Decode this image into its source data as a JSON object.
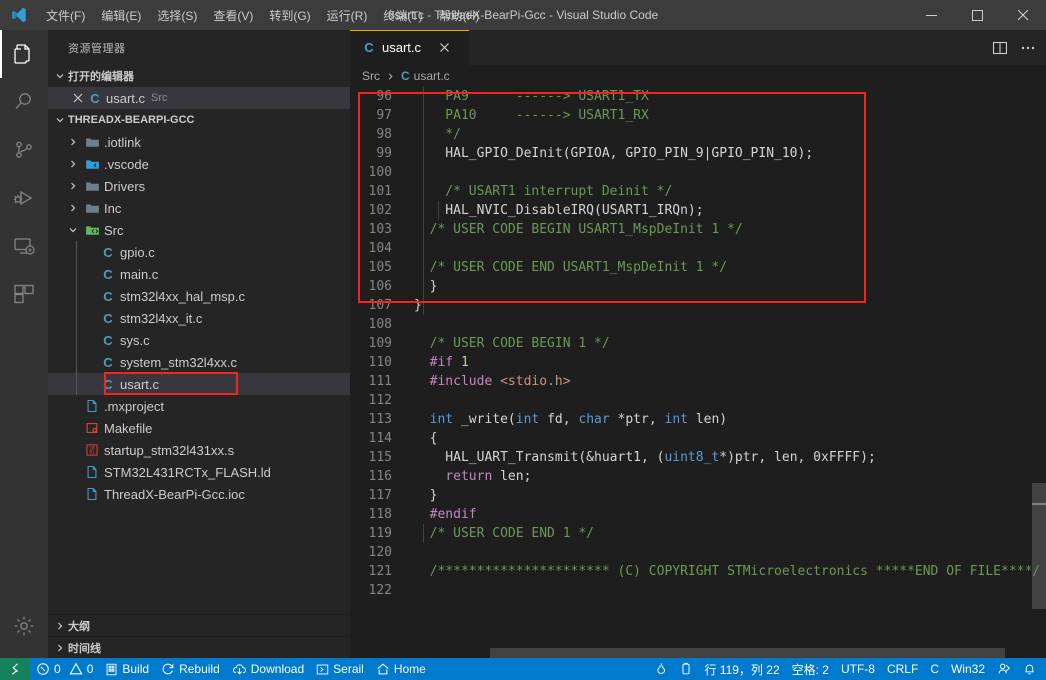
{
  "window": {
    "title": "usart.c - ThreadX-BearPi-Gcc - Visual Studio Code",
    "logo_icon": "vscode-logo-icon",
    "minimize_icon": "minimize-icon",
    "maximize_icon": "maximize-icon",
    "close_icon": "close-icon"
  },
  "menu": {
    "items": [
      {
        "label": "文件(F)",
        "name": "menu-file"
      },
      {
        "label": "编辑(E)",
        "name": "menu-edit"
      },
      {
        "label": "选择(S)",
        "name": "menu-selection"
      },
      {
        "label": "查看(V)",
        "name": "menu-view"
      },
      {
        "label": "转到(G)",
        "name": "menu-go"
      },
      {
        "label": "运行(R)",
        "name": "menu-run"
      },
      {
        "label": "终端(T)",
        "name": "menu-terminal"
      },
      {
        "label": "帮助(H)",
        "name": "menu-help"
      }
    ]
  },
  "activitybar": {
    "items": [
      {
        "name": "activitybar-explorer",
        "icon": "files-icon",
        "active": true
      },
      {
        "name": "activitybar-search",
        "icon": "search-icon",
        "active": false
      },
      {
        "name": "activitybar-source-control",
        "icon": "source-control-icon",
        "active": false
      },
      {
        "name": "activitybar-run-debug",
        "icon": "run-and-debug-icon",
        "active": false
      },
      {
        "name": "activitybar-remote-explorer",
        "icon": "remote-explorer-icon",
        "active": false
      },
      {
        "name": "activitybar-extensions",
        "icon": "extensions-icon",
        "active": false
      }
    ],
    "settings_icon": "gear-icon"
  },
  "sidebar": {
    "title": "资源管理器",
    "open_editors": {
      "header": "打开的编辑器",
      "rows": [
        {
          "close_icon": "close-icon",
          "badge": "C",
          "name": "usart.c",
          "path": "Src"
        }
      ]
    },
    "workspace": {
      "header": "THREADX-BEARPI-GCC",
      "tree": [
        {
          "label": ".iotlink",
          "type": "folder",
          "depth": 1,
          "expanded": false,
          "selected": false
        },
        {
          "label": ".vscode",
          "type": "folder-vs",
          "depth": 1,
          "expanded": false,
          "selected": false
        },
        {
          "label": "Drivers",
          "type": "folder",
          "depth": 1,
          "expanded": false,
          "selected": false
        },
        {
          "label": "Inc",
          "type": "folder",
          "depth": 1,
          "expanded": false,
          "selected": false
        },
        {
          "label": "Src",
          "type": "folder-src",
          "depth": 1,
          "expanded": true,
          "selected": false
        },
        {
          "label": "gpio.c",
          "type": "c",
          "depth": 2,
          "selected": false
        },
        {
          "label": "main.c",
          "type": "c",
          "depth": 2,
          "selected": false
        },
        {
          "label": "stm32l4xx_hal_msp.c",
          "type": "c",
          "depth": 2,
          "selected": false
        },
        {
          "label": "stm32l4xx_it.c",
          "type": "c",
          "depth": 2,
          "selected": false
        },
        {
          "label": "sys.c",
          "type": "c",
          "depth": 2,
          "selected": false
        },
        {
          "label": "system_stm32l4xx.c",
          "type": "c",
          "depth": 2,
          "selected": false
        },
        {
          "label": "usart.c",
          "type": "c",
          "depth": 2,
          "selected": true,
          "highlight": true
        },
        {
          "label": ".mxproject",
          "type": "file",
          "depth": 1,
          "selected": false
        },
        {
          "label": "Makefile",
          "type": "makefile",
          "depth": 1,
          "selected": false
        },
        {
          "label": "startup_stm32l431xx.s",
          "type": "asm",
          "depth": 1,
          "selected": false
        },
        {
          "label": "STM32L431RCTx_FLASH.ld",
          "type": "file",
          "depth": 1,
          "selected": false
        },
        {
          "label": "ThreadX-BearPi-Gcc.ioc",
          "type": "file",
          "depth": 1,
          "selected": false
        }
      ]
    },
    "bottom_sections": [
      {
        "label": "大纲",
        "name": "sidebar-section-outline"
      },
      {
        "label": "时间线",
        "name": "sidebar-section-timeline"
      }
    ]
  },
  "editor": {
    "tab": {
      "badge": "C",
      "label": "usart.c",
      "close_icon": "close-icon"
    },
    "actions": [
      {
        "name": "split-editor-button",
        "icon": "split-editor-icon"
      },
      {
        "name": "more-actions-button",
        "icon": "ellipsis-icon"
      }
    ],
    "breadcrumb": {
      "folder": "Src",
      "badge": "C",
      "file": "usart.c"
    },
    "first_line": 96,
    "highlight_box": {
      "from_line": 109,
      "to_line": 119,
      "color": "#f5251e"
    },
    "lines": [
      {
        "n": 96,
        "tokens": [
          {
            "t": "    PA9      ------> USART1_TX",
            "c": "cmt"
          }
        ]
      },
      {
        "n": 97,
        "tokens": [
          {
            "t": "    PA10     ------> USART1_RX",
            "c": "cmt"
          }
        ]
      },
      {
        "n": 98,
        "tokens": [
          {
            "t": "    */",
            "c": "cmt"
          }
        ]
      },
      {
        "n": 99,
        "tokens": [
          {
            "t": "    HAL_GPIO_DeInit(GPIOA, GPIO_PIN_9|GPIO_PIN_10);",
            "c": "plain"
          }
        ]
      },
      {
        "n": 100,
        "tokens": [
          {
            "t": "",
            "c": "plain"
          }
        ]
      },
      {
        "n": 101,
        "tokens": [
          {
            "t": "    /* USART1 interrupt Deinit */",
            "c": "cmt"
          }
        ]
      },
      {
        "n": 102,
        "tokens": [
          {
            "t": "    HAL_NVIC_DisableIRQ(USART1_IRQn);",
            "c": "plain"
          }
        ]
      },
      {
        "n": 103,
        "tokens": [
          {
            "t": "  /* USER CODE BEGIN USART1_MspDeInit 1 */",
            "c": "cmt"
          }
        ]
      },
      {
        "n": 104,
        "tokens": [
          {
            "t": "",
            "c": "plain"
          }
        ]
      },
      {
        "n": 105,
        "tokens": [
          {
            "t": "  /* USER CODE END USART1_MspDeInit 1 */",
            "c": "cmt"
          }
        ]
      },
      {
        "n": 106,
        "tokens": [
          {
            "t": "  }",
            "c": "plain"
          }
        ]
      },
      {
        "n": 107,
        "tokens": [
          {
            "t": "}",
            "c": "plain"
          }
        ]
      },
      {
        "n": 108,
        "tokens": [
          {
            "t": "",
            "c": "plain"
          }
        ]
      },
      {
        "n": 109,
        "tokens": [
          {
            "t": "  /* USER CODE BEGIN 1 */",
            "c": "cmt"
          }
        ]
      },
      {
        "n": 110,
        "tokens": [
          {
            "t": "  ",
            "c": "plain"
          },
          {
            "t": "#if",
            "c": "pre"
          },
          {
            "t": " ",
            "c": "plain"
          },
          {
            "t": "1",
            "c": "num"
          }
        ]
      },
      {
        "n": 111,
        "tokens": [
          {
            "t": "  ",
            "c": "plain"
          },
          {
            "t": "#include",
            "c": "pre"
          },
          {
            "t": " ",
            "c": "plain"
          },
          {
            "t": "<stdio.h>",
            "c": "str"
          }
        ]
      },
      {
        "n": 112,
        "tokens": [
          {
            "t": "",
            "c": "plain"
          }
        ]
      },
      {
        "n": 113,
        "tokens": [
          {
            "t": "  ",
            "c": "plain"
          },
          {
            "t": "int",
            "c": "kw"
          },
          {
            "t": " _write(",
            "c": "plain"
          },
          {
            "t": "int",
            "c": "kw"
          },
          {
            "t": " fd, ",
            "c": "plain"
          },
          {
            "t": "char",
            "c": "kw"
          },
          {
            "t": " *ptr, ",
            "c": "plain"
          },
          {
            "t": "int",
            "c": "kw"
          },
          {
            "t": " len)",
            "c": "plain"
          }
        ]
      },
      {
        "n": 114,
        "tokens": [
          {
            "t": "  {",
            "c": "plain"
          }
        ]
      },
      {
        "n": 115,
        "tokens": [
          {
            "t": "    HAL_UART_Transmit(&huart1, (",
            "c": "plain"
          },
          {
            "t": "uint8_t",
            "c": "kw"
          },
          {
            "t": "*)ptr, len, 0xFFFF);",
            "c": "plain"
          }
        ]
      },
      {
        "n": 116,
        "tokens": [
          {
            "t": "    ",
            "c": "plain"
          },
          {
            "t": "return",
            "c": "pre"
          },
          {
            "t": " len;",
            "c": "plain"
          }
        ]
      },
      {
        "n": 117,
        "tokens": [
          {
            "t": "  }",
            "c": "plain"
          }
        ]
      },
      {
        "n": 118,
        "tokens": [
          {
            "t": "  ",
            "c": "plain"
          },
          {
            "t": "#endif",
            "c": "pre"
          }
        ]
      },
      {
        "n": 119,
        "tokens": [
          {
            "t": "  /* USER CODE END 1 */",
            "c": "cmt"
          }
        ]
      },
      {
        "n": 120,
        "tokens": [
          {
            "t": "",
            "c": "plain"
          }
        ]
      },
      {
        "n": 121,
        "tokens": [
          {
            "t": "  /********************** (C) COPYRIGHT STMicroelectronics *****END OF FILE****/",
            "c": "cmt"
          }
        ]
      },
      {
        "n": 122,
        "tokens": [
          {
            "t": "",
            "c": "plain"
          }
        ]
      }
    ]
  },
  "statusbar": {
    "remote_icon": "remote-host-icon",
    "left": [
      {
        "name": "status-problems",
        "icon": "error-icon",
        "label": "0",
        "icon2": "warning-icon",
        "label2": "0"
      },
      {
        "name": "status-build",
        "icon": "build-icon",
        "label": "Build"
      },
      {
        "name": "status-rebuild",
        "icon": "rebuild-icon",
        "label": "Rebuild"
      },
      {
        "name": "status-download",
        "icon": "download-icon",
        "label": "Download"
      },
      {
        "name": "status-serail",
        "icon": "terminal-icon",
        "label": "Serail"
      },
      {
        "name": "status-home",
        "icon": "home-icon",
        "label": "Home"
      }
    ],
    "right": [
      {
        "name": "status-flame",
        "icon": "flame-icon",
        "label": ""
      },
      {
        "name": "status-battery",
        "icon": "battery-icon",
        "label": ""
      },
      {
        "name": "status-cursor",
        "label": "行 119，列 22"
      },
      {
        "name": "status-indentation",
        "label": "空格: 2"
      },
      {
        "name": "status-encoding",
        "label": "UTF-8"
      },
      {
        "name": "status-eol",
        "label": "CRLF"
      },
      {
        "name": "status-language",
        "label": "C"
      },
      {
        "name": "status-platform",
        "label": "Win32"
      },
      {
        "name": "status-feedback",
        "icon": "feedback-icon",
        "label": ""
      },
      {
        "name": "status-notifications",
        "icon": "bell-icon",
        "label": ""
      }
    ]
  },
  "colors": {
    "accent": "#007acc",
    "remote_green": "#16825d",
    "tab_active_border": "#e7b000",
    "highlight_red": "#f5251e",
    "c_blue": "#519aba"
  }
}
